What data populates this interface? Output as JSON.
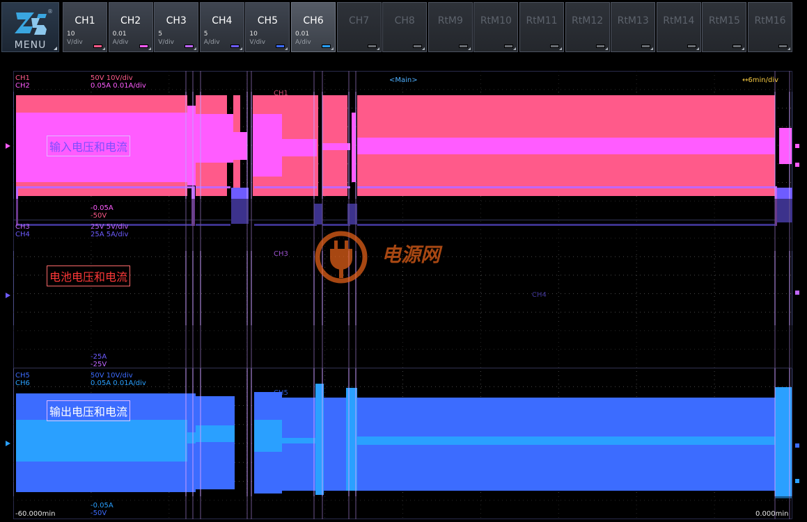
{
  "menu": {
    "label": "MENU",
    "reg": "®"
  },
  "channels": [
    {
      "name": "CH1",
      "value": "10",
      "unit": "V/div",
      "color": "#ff5a8a",
      "state": "on"
    },
    {
      "name": "CH2",
      "value": "0.01",
      "unit": "A/div",
      "color": "#ff5cff",
      "state": "on"
    },
    {
      "name": "CH3",
      "value": "5",
      "unit": "V/div",
      "color": "#c066ff",
      "state": "on"
    },
    {
      "name": "CH4",
      "value": "5",
      "unit": "A/div",
      "color": "#6e5cff",
      "state": "on"
    },
    {
      "name": "CH5",
      "value": "10",
      "unit": "V/div",
      "color": "#3c6cff",
      "state": "on"
    },
    {
      "name": "CH6",
      "value": "0.01",
      "unit": "A/div",
      "color": "#2aa0ff",
      "state": "active"
    },
    {
      "name": "CH7",
      "value": "",
      "unit": "",
      "color": "#6a6e74",
      "state": "off"
    },
    {
      "name": "CH8",
      "value": "",
      "unit": "",
      "color": "#6a6e74",
      "state": "off"
    },
    {
      "name": "RtM9",
      "value": "",
      "unit": "",
      "color": "#6a6e74",
      "state": "off"
    },
    {
      "name": "RtM10",
      "value": "",
      "unit": "",
      "color": "#6a6e74",
      "state": "off"
    },
    {
      "name": "RtM11",
      "value": "",
      "unit": "",
      "color": "#6a6e74",
      "state": "off"
    },
    {
      "name": "RtM12",
      "value": "",
      "unit": "",
      "color": "#6a6e74",
      "state": "off"
    },
    {
      "name": "RtM13",
      "value": "",
      "unit": "",
      "color": "#6a6e74",
      "state": "off"
    },
    {
      "name": "RtM14",
      "value": "",
      "unit": "",
      "color": "#6a6e74",
      "state": "off"
    },
    {
      "name": "RtM15",
      "value": "",
      "unit": "",
      "color": "#6a6e74",
      "state": "off"
    },
    {
      "name": "RtM16",
      "value": "",
      "unit": "",
      "color": "#6a6e74",
      "state": "off"
    }
  ],
  "screen": {
    "main_label": "<Main>",
    "timebase": "↔6min/div",
    "time_start": "-60.000min",
    "time_end": "0.000min"
  },
  "panels": [
    {
      "ch_a": "CH1",
      "ch_b": "CH2",
      "scale_a": "50V   10V/div",
      "scale_b": "0.05A   0.01A/div",
      "bottom_b": "-0.05A",
      "bottom_a": "-50V",
      "trace_label": "CH1",
      "title": "输入电压和电流",
      "color_a": "#ff5a8a",
      "color_b": "#ff5cff",
      "title_color": "#7d4dff"
    },
    {
      "ch_a": "CH3",
      "ch_b": "CH4",
      "scale_a": "25V   5V/div",
      "scale_b": "25A   5A/div",
      "bottom_b": "-25A",
      "bottom_a": "-25V",
      "trace_label": "CH3",
      "trace_label_b": "CH4",
      "title": "电池电压和电流",
      "color_a": "#c066ff",
      "color_b": "#6e5cff",
      "title_color": "#ff3838"
    },
    {
      "ch_a": "CH5",
      "ch_b": "CH6",
      "scale_a": "50V   10V/div",
      "scale_b": "0.05A   0.01A/div",
      "bottom_b": "-0.05A",
      "bottom_a": "-50V",
      "trace_label": "CH5",
      "title": "输出电压和电流",
      "color_a": "#3c6cff",
      "color_b": "#2aa0ff",
      "title_color": "#ffffff"
    }
  ],
  "watermark": {
    "text": "电源网",
    "color": "#ff6a1a",
    "icon": "plug-icon"
  }
}
